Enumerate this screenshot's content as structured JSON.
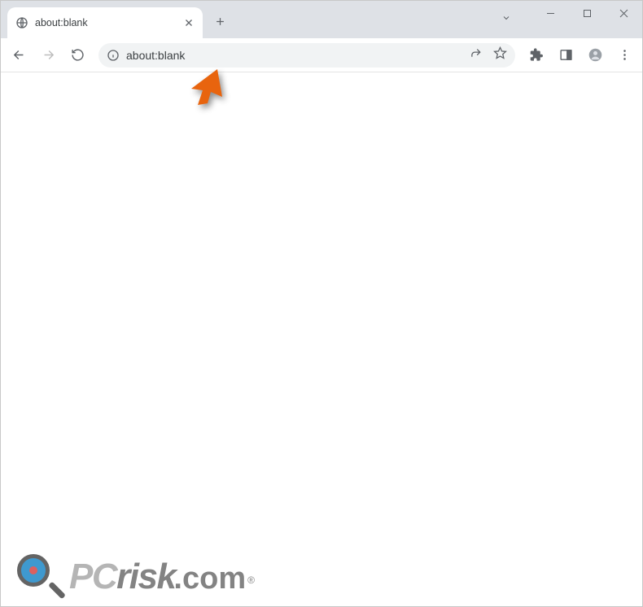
{
  "tab": {
    "title": "about:blank"
  },
  "address": {
    "url": "about:blank"
  },
  "watermark": {
    "pc": "PC",
    "risk": "risk",
    "com": ".com",
    "reg": "®"
  },
  "icons": {
    "globe": "globe-icon",
    "close": "close-icon",
    "plus": "plus-icon",
    "chevron": "chevron-down-icon",
    "minimize": "minimize-icon",
    "maximize": "maximize-icon",
    "windowclose": "window-close-icon",
    "back": "back-icon",
    "forward": "forward-icon",
    "reload": "reload-icon",
    "info": "info-icon",
    "share": "share-icon",
    "star": "star-icon",
    "puzzle": "extensions-icon",
    "side": "side-panel-icon",
    "profile": "profile-icon",
    "menu": "menu-icon",
    "cursor": "cursor-icon",
    "lens": "magnifier-icon"
  }
}
